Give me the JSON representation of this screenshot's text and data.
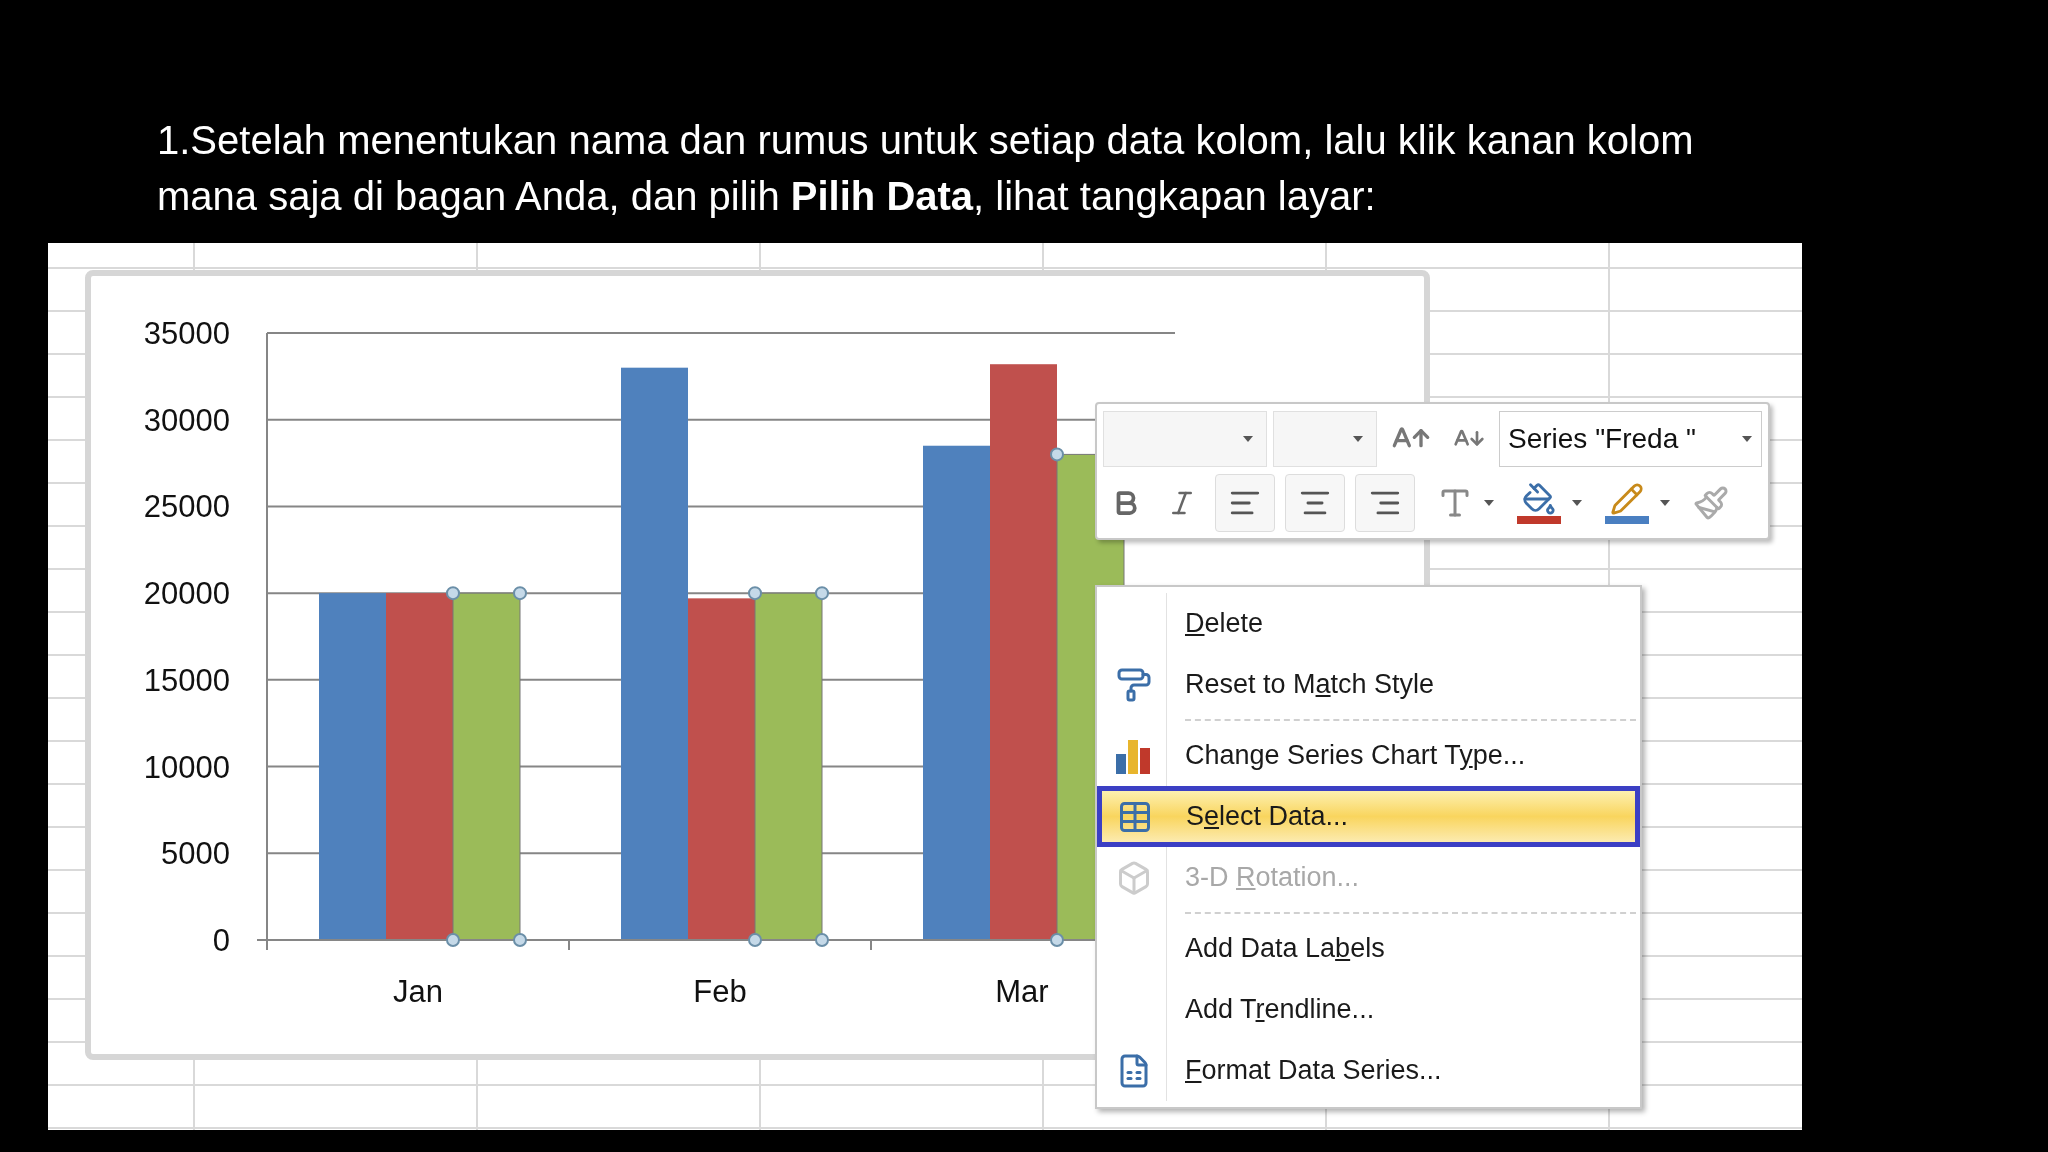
{
  "heading": "1.Setelah menentukan nama dan rumus untuk setiap data kolom, lalu klik kanan kolom mana saja di bagan Anda, dan pilih **Pilih Data**, lihat tangkapan layar:",
  "chart": {
    "chart_data": {
      "type": "bar",
      "categories": [
        "Jan",
        "Feb",
        "Mar"
      ],
      "series": [
        {
          "color": "#4f81bd",
          "values": [
            20000,
            33000,
            28500
          ]
        },
        {
          "color": "#c0504d",
          "values": [
            20000,
            19700,
            33200
          ]
        },
        {
          "color": "#9bbb59",
          "values": [
            20000,
            20000,
            28000
          ]
        }
      ],
      "ylim": [
        0,
        35000
      ],
      "yticks": [
        0,
        5000,
        10000,
        15000,
        20000,
        25000,
        30000,
        35000
      ],
      "grid": true
    },
    "series_selection": [
      {
        "selected": false
      },
      {
        "selected": false
      },
      {
        "selected": true
      }
    ]
  },
  "mini_toolbar": {
    "series_selector": "Series \"Freda \""
  },
  "context_menu": [
    {
      "kind": "item",
      "label": {
        "key": "D",
        "after": "elete"
      },
      "selected": false,
      "disabled": false
    },
    {
      "kind": "item",
      "label": {
        "before": "Reset to M",
        "key": "a",
        "after": "tch Style"
      },
      "selected": false,
      "disabled": false
    },
    {
      "kind": "separator"
    },
    {
      "kind": "item",
      "label": {
        "before": "Change Series Chart T",
        "key": "y",
        "after": "pe..."
      },
      "selected": false,
      "disabled": false
    },
    {
      "kind": "item",
      "label": {
        "before": "S",
        "key": "e",
        "after": "lect Data..."
      },
      "selected": true,
      "disabled": false
    },
    {
      "kind": "item",
      "label": {
        "before": "3-D ",
        "key": "R",
        "after": "otation..."
      },
      "selected": false,
      "disabled": true
    },
    {
      "kind": "separator"
    },
    {
      "kind": "item",
      "label": {
        "before": "Add Data La",
        "key": "b",
        "after": "els"
      },
      "selected": false,
      "disabled": false
    },
    {
      "kind": "item",
      "label": {
        "before": "Add T",
        "key": "r",
        "after": "endline..."
      },
      "selected": false,
      "disabled": false
    },
    {
      "kind": "item",
      "label": {
        "key": "F",
        "after": "ormat Data Series..."
      },
      "selected": false,
      "disabled": false
    }
  ]
}
